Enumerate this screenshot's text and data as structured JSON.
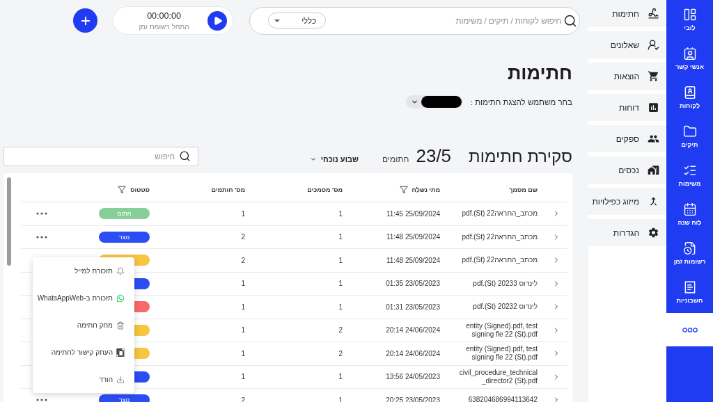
{
  "nav_rail": {
    "items": [
      {
        "label": "לובי"
      },
      {
        "label": "אנשי קשר"
      },
      {
        "label": "לקוחות"
      },
      {
        "label": "תיקים"
      },
      {
        "label": "משימות"
      },
      {
        "label": "לוח שנה"
      },
      {
        "label": "רשומות זמן"
      },
      {
        "label": "חשבוניות"
      }
    ]
  },
  "sidebar": {
    "items": [
      {
        "label": "חתימות"
      },
      {
        "label": "שאלונים"
      },
      {
        "label": "הוצאות"
      },
      {
        "label": "דוחות"
      },
      {
        "label": "ספקים"
      },
      {
        "label": "נכסים"
      },
      {
        "label": "מיזוג כפילויות"
      },
      {
        "label": "הגדרות"
      }
    ]
  },
  "top_bar": {
    "search": {
      "placeholder": "חיפוש לקוחות / תיקים / משימות",
      "scope": "כללי"
    },
    "timer": {
      "time": "00:00:00",
      "caption": "התחל רשומת זמן"
    }
  },
  "page_header": {
    "title": "חתימות",
    "user_filter_label": "בחר משתמש להצגת חתימות :"
  },
  "overview": {
    "title": "סקירת חתימות",
    "count": "23/5",
    "count_label": "חתומים",
    "period": "שבוע נוכחי",
    "search": {
      "placeholder": "חיפוש"
    }
  },
  "table": {
    "columns": [
      {
        "label": "שם מסמך",
        "filter": false
      },
      {
        "label": "מתי נשלח",
        "filter": true
      },
      {
        "label": "מס' מסמכים",
        "filter": false
      },
      {
        "label": "מס' חותמים",
        "filter": false
      },
      {
        "label": "סטטוס",
        "filter": true
      }
    ],
    "rows": [
      {
        "name": "pdf.(St) 22מכתב_התראה",
        "sent": "11:45 25/09/2024",
        "documents": "1",
        "signers": "1",
        "status": {
          "label": "חתום",
          "color": "#86cf98"
        },
        "menu_button": true
      },
      {
        "name": "pdf.(St) 22מכתב_התראה",
        "sent": "11:48 25/09/2024",
        "documents": "1",
        "signers": "2",
        "status": {
          "label": "נוצר",
          "color": "#2b4df3"
        },
        "menu_button": true
      },
      {
        "name": "pdf.(St) 22מכתב_התראה",
        "sent": "11:48 25/09/2024",
        "documents": "1",
        "signers": "2",
        "status": {
          "color": "#f7c540"
        }
      },
      {
        "name": "pdf.(St) 20233 לינדוס",
        "sent": "01:35 23/05/2023",
        "documents": "1",
        "signers": "1",
        "status": {
          "color": "#2b4df3"
        }
      },
      {
        "name": "pdf.(St) 20232 לינדוס",
        "sent": "01:31 23/05/2023",
        "documents": "1",
        "signers": "1",
        "status": {
          "color": "#f76a6a"
        }
      },
      {
        "name": "entity (Signed).pdf, test signing fle 22 (St).pdf",
        "sent": "20:14 24/06/2024",
        "documents": "2",
        "signers": "1",
        "status": {
          "color": "#f7c540"
        }
      },
      {
        "name": "entity (Signed).pdf, test signing fle 22 (St).pdf",
        "sent": "20:14 24/06/2024",
        "documents": "2",
        "signers": "1",
        "status": {
          "color": "#f7c540"
        }
      },
      {
        "name": "civil_procedure_technical_director2 (St).pdf",
        "sent": "13:56 24/05/2023",
        "documents": "1",
        "signers": "1",
        "status": {
          "color": "#2b4df3"
        }
      },
      {
        "name": "638204686994113642",
        "sent": "20:25 23/05/2023",
        "documents": "1",
        "signers": "2",
        "status": {
          "label": "נוצר",
          "color": "#2b4df3"
        },
        "menu_button": true
      }
    ]
  },
  "context_menu": {
    "items": [
      {
        "label": "תזכורת למייל"
      },
      {
        "label": "תזכורת ב-WhatsAppWeb"
      },
      {
        "label": "מחק חתימה"
      },
      {
        "label": "העתק קישור לחתימה"
      },
      {
        "label": "הורד"
      }
    ]
  }
}
